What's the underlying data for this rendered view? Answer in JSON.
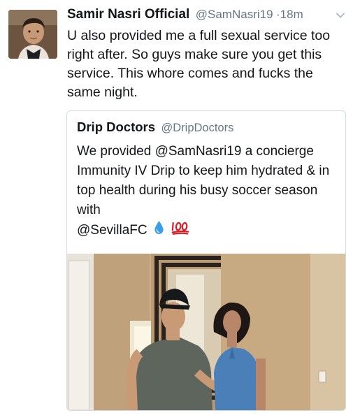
{
  "tweet": {
    "author_name": "Samir Nasri Official",
    "author_handle": "@SamNasri19",
    "separator": "·",
    "timestamp": "18m",
    "text": "U also provided me a full sexual service too right after. So guys make sure you get this service. This whore comes and fucks the same night."
  },
  "quoted": {
    "author_name": "Drip Doctors",
    "author_handle": "@DripDoctors",
    "text": "We provided @SamNasri19 a concierge Immunity IV Drip to keep him hydrated & in top health during his busy soccer season with",
    "last_line": "@SevillaFC",
    "emojis": [
      "droplet-emoji",
      "hundred-points-emoji"
    ]
  },
  "icons": [
    "chevron-down-icon"
  ],
  "colors": {
    "text": "#14171a",
    "secondary": "#657786",
    "border": "#d5dce1",
    "droplet": "#3a9ee8",
    "hundred": "#d8202a"
  }
}
